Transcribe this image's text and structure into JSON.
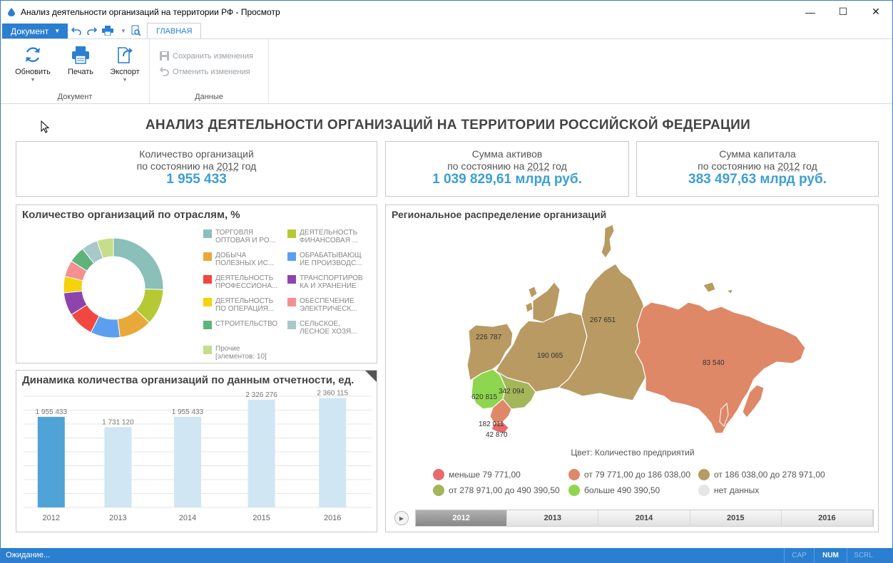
{
  "window": {
    "title": "Анализ деятельности организаций на территории РФ - Просмотр",
    "minimize": "—",
    "maximize": "☐",
    "close": "✕"
  },
  "ribbon": {
    "document_menu": "Документ",
    "tab_home": "ГЛАВНАЯ",
    "groups": {
      "document": {
        "label": "Документ",
        "refresh": "Обновить",
        "print": "Печать",
        "export": "Экспорт"
      },
      "data": {
        "label": "Данные",
        "save": "Сохранить изменения",
        "cancel": "Отменить изменения"
      }
    }
  },
  "report": {
    "title": "АНАЛИЗ ДЕЯТЕЛЬНОСТИ ОРГАНИЗАЦИЙ НА ТЕРРИТОРИИ РОССИЙСКОЙ ФЕДЕРАЦИИ",
    "kpis": [
      {
        "label": "Количество организаций",
        "prefix": "по состоянию на",
        "year": "2012",
        "suffix": "год",
        "value": "1 955 433"
      },
      {
        "label": "Сумма активов",
        "prefix": "по состоянию на",
        "year": "2012",
        "suffix": "год",
        "value": "1 039 829,61 млрд руб."
      },
      {
        "label": "Сумма капитала",
        "prefix": "по состоянию на",
        "year": "2012",
        "suffix": "год",
        "value": "383 497,63 млрд руб."
      }
    ],
    "industries": {
      "title": "Количество организаций по отраслям, %",
      "legend": [
        {
          "line1": "ТОРГОВЛЯ",
          "line2": "ОПТОВАЯ И РО...",
          "color": "#8bbfb9"
        },
        {
          "line1": "ДЕЯТЕЛЬНОСТЬ",
          "line2": "ФИНАНСОВАЯ ...",
          "color": "#b5c934"
        },
        {
          "line1": "ДОБЫЧА",
          "line2": "ПОЛЕЗНЫХ ИС...",
          "color": "#e9a93a"
        },
        {
          "line1": "ОБРАБАТЫВАЮЩ",
          "line2": "ИЕ ПРОИЗВОДС...",
          "color": "#5c9ff0"
        },
        {
          "line1": "ДЕЯТЕЛЬНОСТЬ",
          "line2": "ПРОФЕССИОНА...",
          "color": "#f2473f"
        },
        {
          "line1": "ТРАНСПОРТИРОВ",
          "line2": "КА И ХРАНЕНИЕ",
          "color": "#8e44ad"
        },
        {
          "line1": "ДЕЯТЕЛЬНОСТЬ",
          "line2": "ПО ОПЕРАЦИЯ...",
          "color": "#f5d20a"
        },
        {
          "line1": "ОБЕСПЕЧЕНИЕ",
          "line2": "ЭЛЕКТРИЧЕСК...",
          "color": "#f59090"
        },
        {
          "line1": "СТРОИТЕЛЬСТВО",
          "line2": "",
          "color": "#5fb37a"
        },
        {
          "line1": "СЕЛЬСКОЕ,",
          "line2": "ЛЕСНОЕ ХОЗЯ...",
          "color": "#a8c8c9"
        },
        {
          "line1": "Прочие",
          "line2": "[элементов: 10]",
          "color": "#c6dd8a"
        }
      ]
    },
    "dynamics": {
      "title": "Динамика количества организаций по данным отчетности, ед."
    },
    "map": {
      "title": "Региональное распределение организаций",
      "color_caption": "Цвет: Количество предприятий",
      "regions": [
        {
          "label": "226 787",
          "color": "#b89a62"
        },
        {
          "label": "190 065",
          "color": "#b89a62"
        },
        {
          "label": "267 651",
          "color": "#b89a62"
        },
        {
          "label": "83 540",
          "color": "#de8868"
        },
        {
          "label": "620 815",
          "color": "#8fd650"
        },
        {
          "label": "342 094",
          "color": "#a4b55a"
        },
        {
          "label": "182 011",
          "color": "#de8868"
        },
        {
          "label": "42 870",
          "color": "#e86a6a"
        }
      ],
      "legend": [
        {
          "label": "меньше 79 771,00",
          "color": "#e86a6a"
        },
        {
          "label": "от 79 771,00 до 186 038,00",
          "color": "#de8868"
        },
        {
          "label": "от 186 038,00 до 278 971,00",
          "color": "#b89a62"
        },
        {
          "label": "от 278 971,00 до 490 390,50",
          "color": "#a4b55a"
        },
        {
          "label": "больше 490 390,50",
          "color": "#8fd650"
        },
        {
          "label": "нет данных",
          "color": "#e6e6e6"
        }
      ],
      "timeline": [
        "2012",
        "2013",
        "2014",
        "2015",
        "2016"
      ],
      "timeline_selected": "2012"
    }
  },
  "chart_data": [
    {
      "type": "pie",
      "title": "Количество организаций по отраслям, %",
      "categories": [
        "ТОРГОВЛЯ ОПТОВАЯ И РО...",
        "ДЕЯТЕЛЬНОСТЬ ФИНАНСОВАЯ ...",
        "ДОБЫЧА ПОЛЕЗНЫХ ИС...",
        "ОБРАБАТЫВАЮЩИЕ ПРОИЗВОДС...",
        "ДЕЯТЕЛЬНОСТЬ ПРОФЕССИОНА...",
        "ТРАНСПОРТИРОВКА И ХРАНЕНИЕ",
        "ДЕЯТЕЛЬНОСТЬ ПО ОПЕРАЦИЯ...",
        "ОБЕСПЕЧЕНИЕ ЭЛЕКТРИЧЕСК...",
        "СТРОИТЕЛЬСТВО",
        "СЕЛЬСКОЕ, ЛЕСНОЕ ХОЗЯ...",
        "Прочие [элементов: 10]"
      ],
      "values": [
        24,
        11,
        10,
        9,
        8,
        7,
        5,
        5,
        5,
        5,
        5
      ],
      "colors": [
        "#8bbfb9",
        "#b5c934",
        "#e9a93a",
        "#5c9ff0",
        "#f2473f",
        "#8e44ad",
        "#f5d20a",
        "#f59090",
        "#5fb37a",
        "#a8c8c9",
        "#c6dd8a"
      ],
      "donut": true
    },
    {
      "type": "bar",
      "title": "Динамика количества организаций по данным отчетности, ед.",
      "categories": [
        "2012",
        "2013",
        "2014",
        "2015",
        "2016"
      ],
      "values": [
        1955433,
        1731120,
        1955433,
        2326276,
        2360115
      ],
      "value_labels": [
        "1 955 433",
        "1 731 120",
        "1 955 433",
        "2 326 276",
        "2 360 115"
      ],
      "highlighted": "2012",
      "colors": {
        "selected": "#4fa3d6",
        "other": "#d0e6f2"
      },
      "ylim": [
        0,
        2400000
      ],
      "grid": true
    }
  ]
}
